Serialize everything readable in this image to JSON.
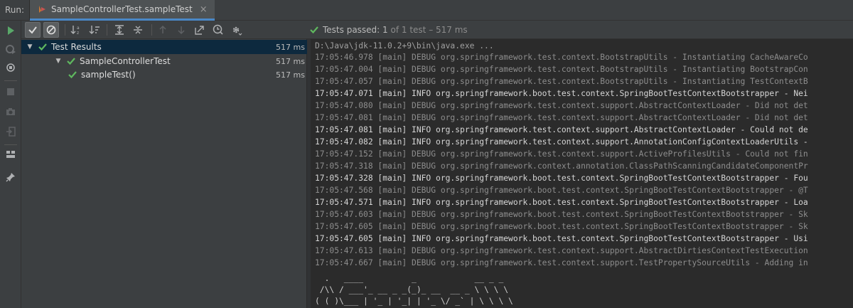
{
  "run": {
    "label": "Run:"
  },
  "tab": {
    "title": "SampleControllerTest.sampleTest",
    "close": "×"
  },
  "status": {
    "prefix": "Tests passed:",
    "count": "1",
    "rest": "of 1 test – 517 ms"
  },
  "tree": [
    {
      "label": "Test Results",
      "time": "517 ms",
      "expanded": true,
      "selected": true
    },
    {
      "label": "SampleControllerTest",
      "time": "517 ms",
      "expanded": true,
      "selected": false
    },
    {
      "label": "sampleTest()",
      "time": "517 ms",
      "expanded": false,
      "selected": false
    }
  ],
  "console": [
    {
      "level": "cmd",
      "text": "D:\\Java\\jdk-11.0.2+9\\bin\\java.exe ..."
    },
    {
      "level": "debug",
      "text": "17:05:46.978 [main] DEBUG org.springframework.test.context.BootstrapUtils - Instantiating CacheAwareCo"
    },
    {
      "level": "debug",
      "text": "17:05:47.004 [main] DEBUG org.springframework.test.context.BootstrapUtils - Instantiating BootstrapCon"
    },
    {
      "level": "debug",
      "text": "17:05:47.057 [main] DEBUG org.springframework.test.context.BootstrapUtils - Instantiating TestContextB"
    },
    {
      "level": "info",
      "text": "17:05:47.071 [main] INFO org.springframework.boot.test.context.SpringBootTestContextBootstrapper - Nei"
    },
    {
      "level": "debug",
      "text": "17:05:47.080 [main] DEBUG org.springframework.test.context.support.AbstractContextLoader - Did not det"
    },
    {
      "level": "debug",
      "text": "17:05:47.081 [main] DEBUG org.springframework.test.context.support.AbstractContextLoader - Did not det"
    },
    {
      "level": "info",
      "text": "17:05:47.081 [main] INFO org.springframework.test.context.support.AbstractContextLoader - Could not de"
    },
    {
      "level": "info",
      "text": "17:05:47.082 [main] INFO org.springframework.test.context.support.AnnotationConfigContextLoaderUtils -"
    },
    {
      "level": "debug",
      "text": "17:05:47.152 [main] DEBUG org.springframework.test.context.support.ActiveProfilesUtils - Could not fin"
    },
    {
      "level": "debug",
      "text": "17:05:47.318 [main] DEBUG org.springframework.context.annotation.ClassPathScanningCandidateComponentPr"
    },
    {
      "level": "info",
      "text": "17:05:47.328 [main] INFO org.springframework.boot.test.context.SpringBootTestContextBootstrapper - Fou"
    },
    {
      "level": "debug",
      "text": "17:05:47.568 [main] DEBUG org.springframework.boot.test.context.SpringBootTestContextBootstrapper - @T"
    },
    {
      "level": "info",
      "text": "17:05:47.571 [main] INFO org.springframework.boot.test.context.SpringBootTestContextBootstrapper - Loa"
    },
    {
      "level": "debug",
      "text": "17:05:47.603 [main] DEBUG org.springframework.boot.test.context.SpringBootTestContextBootstrapper - Sk"
    },
    {
      "level": "debug",
      "text": "17:05:47.605 [main] DEBUG org.springframework.boot.test.context.SpringBootTestContextBootstrapper - Sk"
    },
    {
      "level": "info",
      "text": "17:05:47.605 [main] INFO org.springframework.boot.test.context.SpringBootTestContextBootstrapper - Usi"
    },
    {
      "level": "debug",
      "text": "17:05:47.613 [main] DEBUG org.springframework.test.context.support.AbstractDirtiesContextTestExecution"
    },
    {
      "level": "debug",
      "text": "17:05:47.667 [main] DEBUG org.springframework.test.context.support.TestPropertySourceUtils - Adding in"
    },
    {
      "level": "banner",
      "text": ""
    },
    {
      "level": "banner",
      "text": ""
    },
    {
      "level": "banner",
      "text": "  .   ____          _            __ _ _"
    },
    {
      "level": "banner",
      "text": " /\\\\ / ___'_ __ _ _(_)_ __  __ _ \\ \\ \\ \\"
    },
    {
      "level": "banner",
      "text": "( ( )\\___ | '_ | '_| | '_ \\/ _` | \\ \\ \\ \\"
    }
  ],
  "colors": {
    "accent": "#4a88c7",
    "pass": "#5fb85f",
    "selected": "#0d293e",
    "run": "#59a869"
  },
  "icons": {
    "left": [
      "rerun-icon",
      "rerun-failed-icon",
      "toggle-auto-test-icon",
      "stop-icon",
      "screenshot-icon",
      "exit-icon",
      "layout-icon",
      "pin-icon"
    ],
    "toolbar": [
      "show-passed-icon",
      "show-ignored-icon",
      "sort-alpha-icon",
      "sort-duration-icon",
      "expand-all-icon",
      "collapse-all-icon",
      "previous-test-icon",
      "next-test-icon",
      "export-icon",
      "history-icon",
      "settings-icon"
    ]
  }
}
